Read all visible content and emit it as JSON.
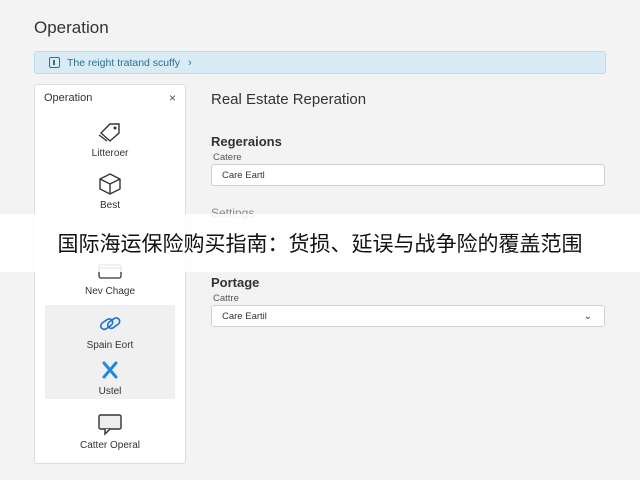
{
  "app": {
    "title": "Operation"
  },
  "breadcrumb": {
    "text": "The reight tratand scuffy",
    "icon": "info-icon",
    "chevron": "›"
  },
  "sidebar": {
    "title": "Operation",
    "close": "×",
    "items": [
      {
        "label": "Litteroer",
        "icon": "tag-icon"
      },
      {
        "label": "Best",
        "icon": "cube-icon"
      },
      {
        "label": "Nev Chage",
        "icon": "folder-icon"
      },
      {
        "label": "Spain Eort",
        "icon": "link-icon"
      },
      {
        "label": "Ustel",
        "icon": "close-x-icon"
      },
      {
        "label": "Catter Operal",
        "icon": "chat-bubble-icon"
      }
    ]
  },
  "main": {
    "title": "Real Estate Reperation",
    "sections": [
      {
        "heading": "Regeraions",
        "field_label": "Catere",
        "value": "Care Eartl"
      },
      {
        "heading": "Portage",
        "field_label": "Cattre",
        "value": "Care Eartil"
      }
    ],
    "settings_label": "Settings"
  },
  "overlay": {
    "text": "国际海运保险购买指南：货损、延误与战争险的覆盖范围"
  },
  "colors": {
    "accent": "#1e88e5",
    "breadcrumb_bg": "#d9ecf6",
    "breadcrumb_text": "#2c6f93"
  }
}
